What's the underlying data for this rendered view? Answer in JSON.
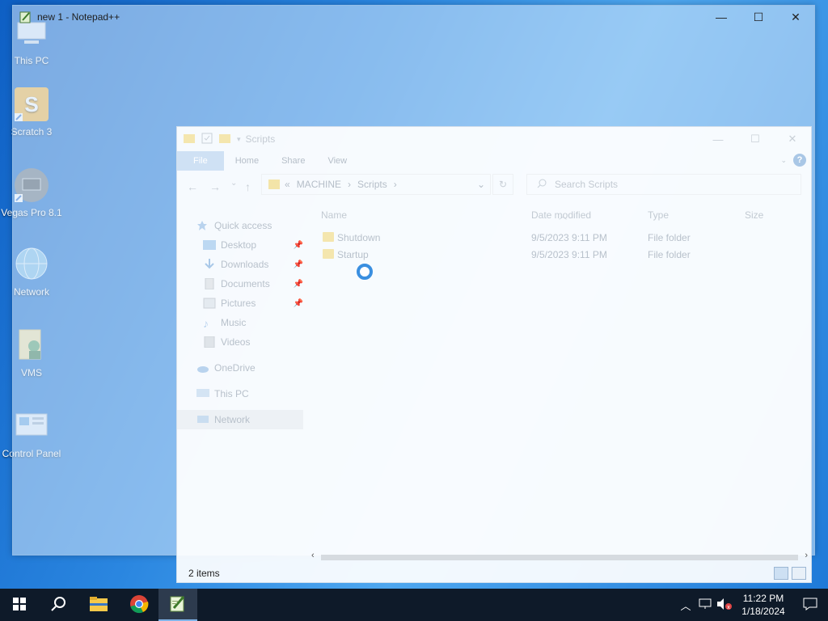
{
  "desktop": {
    "icons": [
      {
        "label": "This PC",
        "icon": "this-pc-icon"
      },
      {
        "label": "Scratch 3",
        "icon": "scratch-icon"
      },
      {
        "label": "Vegas Pro 8.1",
        "icon": "vegas-pro-icon"
      },
      {
        "label": "Network",
        "icon": "network-globe-icon"
      },
      {
        "label": "VMS",
        "icon": "vms-folder-icon"
      },
      {
        "label": "Control Panel",
        "icon": "control-panel-icon"
      }
    ]
  },
  "notepad": {
    "title": "new 1 - Notepad++",
    "controls": {
      "minimize": "—",
      "maximize": "☐",
      "close": "✕"
    }
  },
  "explorer": {
    "title": "Scripts",
    "controls": {
      "minimize": "—",
      "maximize": "☐",
      "close": "✕"
    },
    "ribbon_tabs": [
      "File",
      "Home",
      "Share",
      "View"
    ],
    "help": "?",
    "nav": {
      "back": "←",
      "forward": "→",
      "recent": "⌄",
      "up": "↑"
    },
    "address": {
      "prefix": "«",
      "crumbs": [
        "MACHINE",
        "Scripts"
      ],
      "sep": "›"
    },
    "refresh": "↻",
    "search_placeholder": "Search Scripts",
    "nav_pane": [
      {
        "label": "Quick access",
        "icon": "star-icon",
        "pinned": false
      },
      {
        "label": "Desktop",
        "icon": "desktop-icon",
        "pinned": true
      },
      {
        "label": "Downloads",
        "icon": "download-icon",
        "pinned": true
      },
      {
        "label": "Documents",
        "icon": "document-icon",
        "pinned": true
      },
      {
        "label": "Pictures",
        "icon": "picture-icon",
        "pinned": true
      },
      {
        "label": "Music",
        "icon": "music-icon",
        "pinned": false
      },
      {
        "label": "Videos",
        "icon": "video-icon",
        "pinned": false
      },
      {
        "label": "OneDrive",
        "icon": "cloud-icon",
        "pinned": false
      },
      {
        "label": "This PC",
        "icon": "computer-icon",
        "pinned": false
      },
      {
        "label": "Network",
        "icon": "network-icon",
        "pinned": false
      }
    ],
    "columns": [
      "Name",
      "Date modified",
      "Type",
      "Size"
    ],
    "files": [
      {
        "name": "Shutdown",
        "date": "9/5/2023 9:11 PM",
        "type": "File folder",
        "size": ""
      },
      {
        "name": "Startup",
        "date": "9/5/2023 9:11 PM",
        "type": "File folder",
        "size": ""
      }
    ],
    "status": "2 items"
  },
  "taskbar": {
    "apps": [
      {
        "name": "start",
        "icon": "windows-start-icon"
      },
      {
        "name": "search",
        "icon": "search-icon"
      },
      {
        "name": "file-explorer",
        "icon": "folder-icon"
      },
      {
        "name": "chrome",
        "icon": "chrome-icon"
      },
      {
        "name": "notepad-plus-plus",
        "icon": "notepad-plus-plus-icon"
      }
    ],
    "clock": {
      "time": "11:22 PM",
      "date": "1/18/2024"
    }
  }
}
